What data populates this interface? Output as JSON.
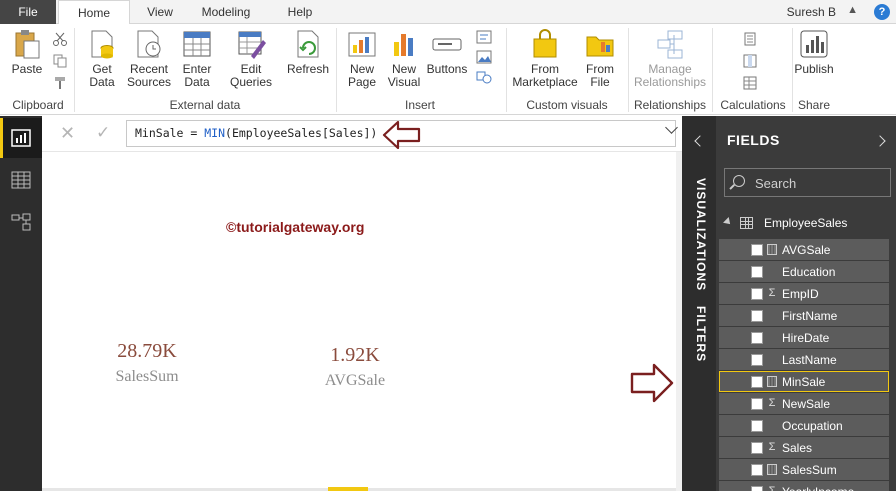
{
  "tabs": {
    "file": "File",
    "items": [
      "Home",
      "View",
      "Modeling",
      "Help"
    ],
    "active": "Home"
  },
  "user": "Suresh B",
  "ribbon": {
    "groups": {
      "clipboard": "Clipboard",
      "external_data": "External data",
      "insert": "Insert",
      "custom_visuals": "Custom visuals",
      "relationships": "Relationships",
      "calculations": "Calculations",
      "share": "Share"
    },
    "buttons": {
      "paste": "Paste",
      "get_data": "Get\nData",
      "recent_sources": "Recent\nSources",
      "enter_data": "Enter\nData",
      "edit_queries": "Edit\nQueries",
      "refresh": "Refresh",
      "new_page": "New\nPage",
      "new_visual": "New\nVisual",
      "buttons": "Buttons",
      "from_marketplace": "From\nMarketplace",
      "from_file": "From\nFile",
      "manage_relationships": "Manage\nRelationships",
      "publish": "Publish"
    }
  },
  "formula": {
    "measure_name": "MinSale",
    "equals": " = ",
    "function": "MIN",
    "argument": "(EmployeeSales[Sales])"
  },
  "canvas": {
    "watermark": "©tutorialgateway.org",
    "cards": [
      {
        "value": "28.79K",
        "label": "SalesSum"
      },
      {
        "value": "1.92K",
        "label": "AVGSale"
      }
    ]
  },
  "panes": {
    "visualizations": "VISUALIZATIONS",
    "filters": "FILTERS",
    "fields_title": "FIELDS",
    "search_placeholder": "Search",
    "table_name": "EmployeeSales",
    "fields": [
      {
        "name": "AVGSale",
        "type": "calc",
        "selected": false
      },
      {
        "name": "Education",
        "type": "text",
        "selected": false
      },
      {
        "name": "EmpID",
        "type": "sum",
        "selected": false
      },
      {
        "name": "FirstName",
        "type": "text",
        "selected": false
      },
      {
        "name": "HireDate",
        "type": "text",
        "selected": false
      },
      {
        "name": "LastName",
        "type": "text",
        "selected": false
      },
      {
        "name": "MinSale",
        "type": "calc",
        "selected": true
      },
      {
        "name": "NewSale",
        "type": "sum",
        "selected": false
      },
      {
        "name": "Occupation",
        "type": "text",
        "selected": false
      },
      {
        "name": "Sales",
        "type": "sum",
        "selected": false
      },
      {
        "name": "SalesSum",
        "type": "calc",
        "selected": false
      },
      {
        "name": "YearlyIncome",
        "type": "sum",
        "selected": false
      }
    ]
  },
  "colors": {
    "accent": "#f2c811",
    "annotation_arrow": "#7a1f1f",
    "watermark": "#8b1a1a"
  }
}
